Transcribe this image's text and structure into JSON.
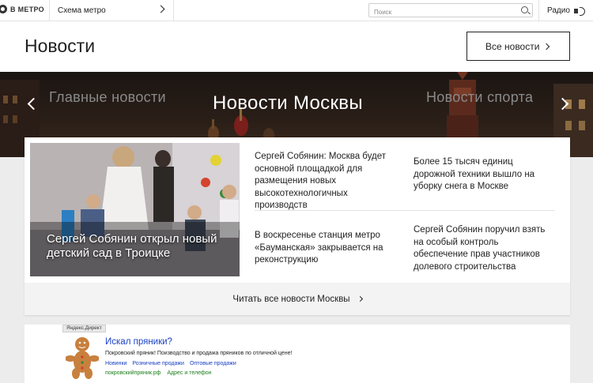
{
  "topbar": {
    "logo_text": "В МЕТРО",
    "scheme_label": "Схема метро",
    "search_placeholder": "Поиск",
    "radio_label": "Радио"
  },
  "header": {
    "title": "Новости",
    "all_news_button": "Все новости"
  },
  "carousel": {
    "prev_tab": "Главные новости",
    "active_tab": "Новости Москвы",
    "next_tab": "Новости спорта"
  },
  "news": {
    "feature_caption": "Сергей Собянин открыл новый детский сад в Троицке",
    "stories": [
      "Сергей Собянин: Москва будет основной площадкой для размещения новых высокотехнологичных производств",
      "Более 15 тысяч единиц дорожной техники вышло на уборку снега в Москве",
      "В воскресенье станция метро «Бауманская» закрывается на реконструкцию",
      "Сергей Собянин поручил взять на особый контроль обеспечение прав участников долевого строительства"
    ],
    "read_all": "Читать все новости Москвы"
  },
  "ad": {
    "badge": "Яндекс.Директ",
    "title": "Искал пряники?",
    "text": "Покровский пряник! Поизводство и продажа пряников по отличной цене!",
    "links": [
      "Новинки",
      "Розничные продажи",
      "Оптовые продажи"
    ],
    "domain": "покровскийпряник.рф",
    "contact": "Адрес и телефон"
  }
}
